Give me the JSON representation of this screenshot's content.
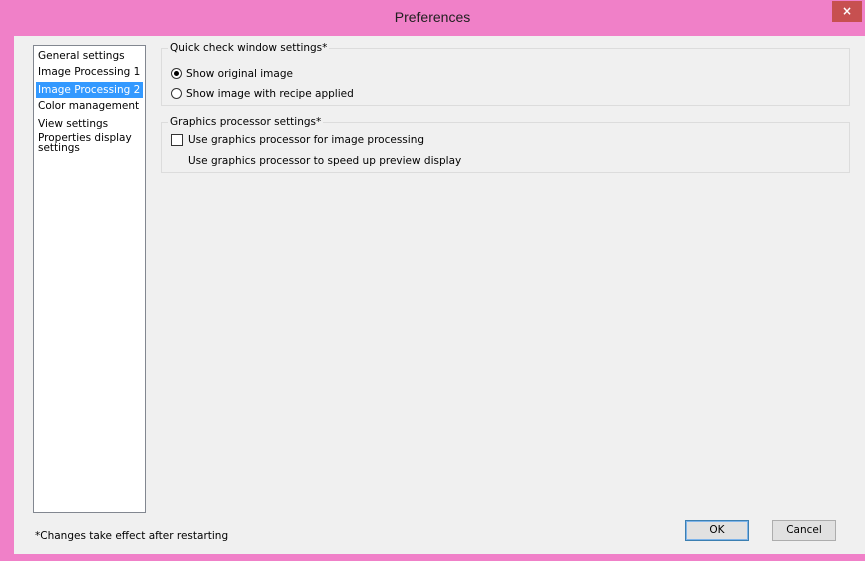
{
  "window": {
    "title": "Preferences",
    "close_glyph": "×"
  },
  "sidebar": {
    "items": [
      {
        "label": "General settings"
      },
      {
        "label": "Image Processing 1"
      },
      {
        "label": "Image Processing 2",
        "selected": true
      },
      {
        "label": "Color management"
      },
      {
        "label": "View settings"
      },
      {
        "label": "Properties display settings"
      }
    ]
  },
  "quick_check": {
    "title": "Quick check window settings*",
    "options": [
      {
        "label": "Show original image",
        "checked": true
      },
      {
        "label": "Show image with recipe applied",
        "checked": false
      }
    ]
  },
  "gpu": {
    "title": "Graphics processor settings*",
    "checkbox_label": "Use graphics processor for image processing",
    "checked": false,
    "description": "Use graphics processor to speed up preview display"
  },
  "footer": {
    "note": "*Changes take effect after restarting",
    "ok_label": "OK",
    "cancel_label": "Cancel"
  },
  "colors": {
    "frame": "#f080c8",
    "selection": "#3399ff",
    "close": "#c75050"
  }
}
